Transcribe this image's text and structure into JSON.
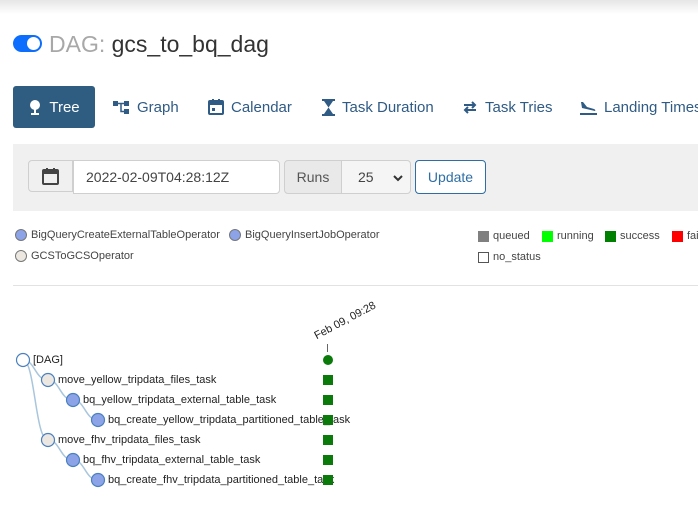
{
  "header": {
    "dag_prefix": "DAG:",
    "dag_name": "gcs_to_bq_dag",
    "paused_toggle": "on"
  },
  "tabs": [
    {
      "label": "Tree",
      "icon": "tree-icon",
      "active": true
    },
    {
      "label": "Graph",
      "icon": "graph-icon",
      "active": false
    },
    {
      "label": "Calendar",
      "icon": "calendar-icon",
      "active": false
    },
    {
      "label": "Task Duration",
      "icon": "hourglass-icon",
      "active": false
    },
    {
      "label": "Task Tries",
      "icon": "repeat-icon",
      "active": false
    },
    {
      "label": "Landing Times",
      "icon": "plane-landing-icon",
      "active": false
    }
  ],
  "controls": {
    "base_date": "2022-02-09T04:28:12Z",
    "runs_label": "Runs",
    "runs_value": "25",
    "update_label": "Update"
  },
  "operators": [
    {
      "label": "BigQueryCreateExternalTableOperator",
      "color": "#8ca3e8"
    },
    {
      "label": "BigQueryInsertJobOperator",
      "color": "#8ca3e8"
    },
    {
      "label": "GCSToGCSOperator",
      "color": "#ece8e1"
    }
  ],
  "states": [
    {
      "label": "queued",
      "color": "#808080"
    },
    {
      "label": "running",
      "color": "#00ff00"
    },
    {
      "label": "success",
      "color": "#008000"
    },
    {
      "label": "fai",
      "color": "#ff0000"
    },
    {
      "label": "no_status",
      "color": "#ffffff"
    }
  ],
  "tree": {
    "run_date": "Feb 09, 09:28",
    "nodes": [
      {
        "label": "[DAG]",
        "state": "success"
      },
      {
        "label": "move_yellow_tripdata_files_task",
        "state": "success"
      },
      {
        "label": "bq_yellow_tripdata_external_table_task",
        "state": "success"
      },
      {
        "label": "bq_create_yellow_tripdata_partitioned_table_task",
        "state": "success"
      },
      {
        "label": "move_fhv_tripdata_files_task",
        "state": "success"
      },
      {
        "label": "bq_fhv_tripdata_external_table_task",
        "state": "success"
      },
      {
        "label": "bq_create_fhv_tripdata_partitioned_table_task",
        "state": "success"
      }
    ]
  }
}
